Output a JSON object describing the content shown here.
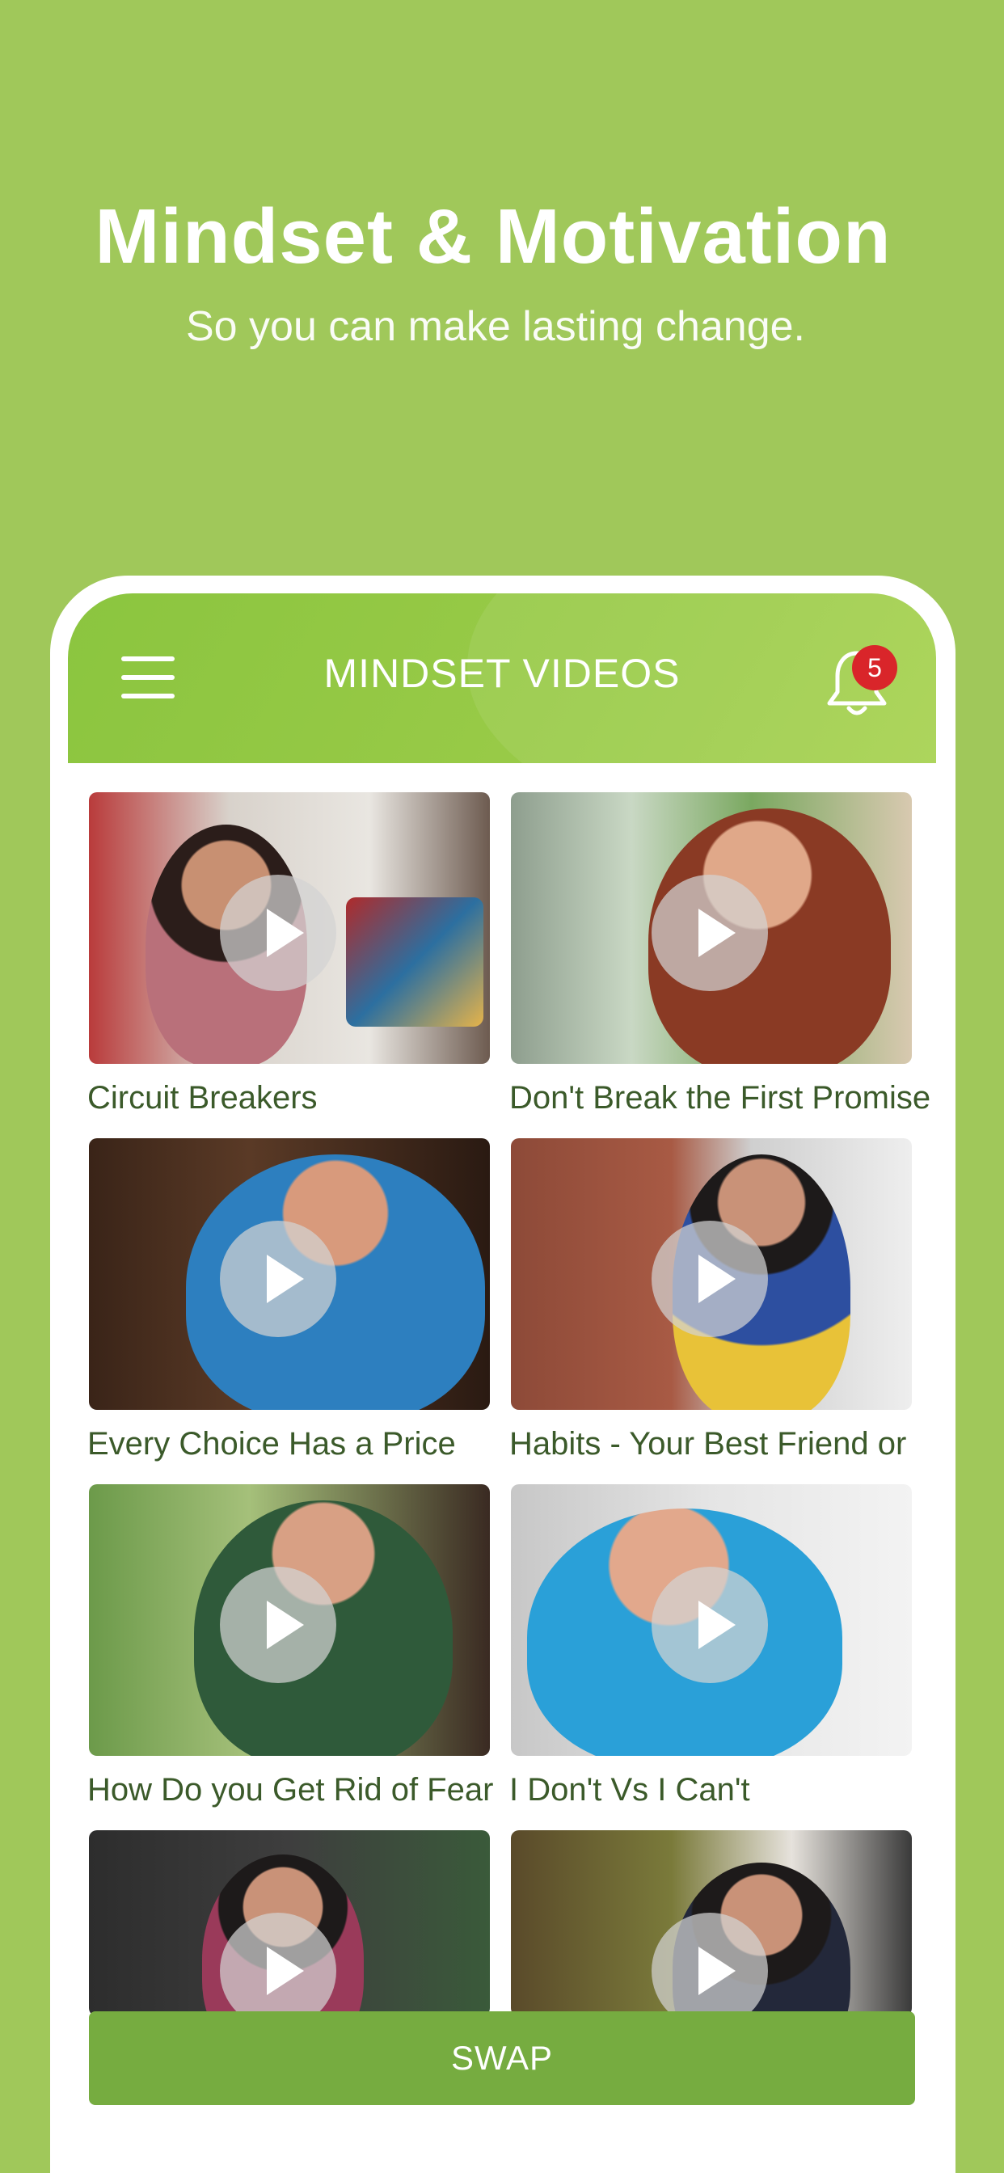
{
  "hero": {
    "title": "Mindset & Motivation",
    "subtitle": "So you can make lasting change."
  },
  "app_header": {
    "title": "MINDSET VIDEOS",
    "notification_count": "5",
    "menu_icon": "hamburger-menu-icon",
    "bell_icon": "bell-icon"
  },
  "videos": [
    {
      "label": "Circuit Breakers"
    },
    {
      "label": "Don't Break the First Promise"
    },
    {
      "label": "Every Choice Has a Price"
    },
    {
      "label": "Habits - Your Best Friend or"
    },
    {
      "label": "How Do you Get Rid of Fear"
    },
    {
      "label": "I Don't Vs I Can't"
    },
    {
      "label": ""
    },
    {
      "label": ""
    }
  ],
  "swap_button": {
    "label": "SWAP"
  },
  "colors": {
    "background": "#a0c85a",
    "header": "#8bc53f",
    "swap": "#76ac40",
    "badge": "#d9252a",
    "label_text": "#3b5a2a"
  }
}
